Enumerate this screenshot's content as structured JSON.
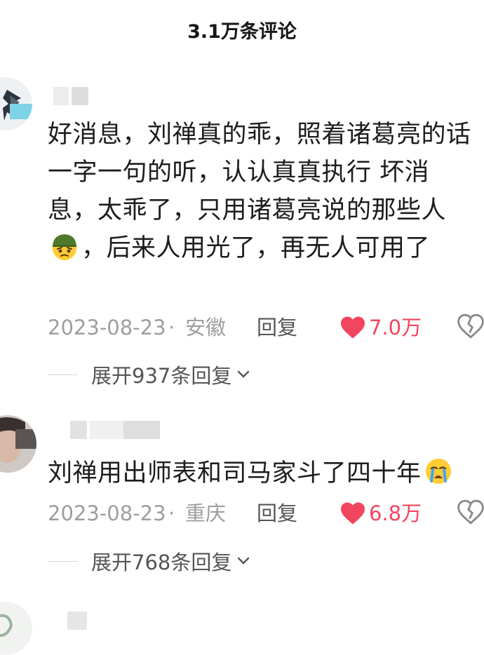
{
  "header": {
    "title": "3.1万条评论"
  },
  "comments": [
    {
      "text_parts": [
        "好消息，刘禅真的乖，照着诸葛亮的话一字一句的听，认认真真执行 坏消息，太乖了，只用诸葛亮说的那些人",
        "，后来人用光了，再无人可用了"
      ],
      "emoji": "thinking-soldier-emoji",
      "date": "2023-08-23",
      "sep": "·",
      "location": "安徽",
      "reply_label": "回复",
      "likes": "7.0万",
      "expand_label": "展开937条回复"
    },
    {
      "text_parts": [
        "刘禅用出师表和司马家斗了四十年"
      ],
      "emoji": "crying-emoji",
      "date": "2023-08-23",
      "sep": "·",
      "location": "重庆",
      "reply_label": "回复",
      "likes": "6.8万",
      "expand_label": "展开768条回复"
    }
  ],
  "colors": {
    "like": "#f2455e",
    "meta": "#9e9e9e",
    "text": "#1d1d1d"
  }
}
